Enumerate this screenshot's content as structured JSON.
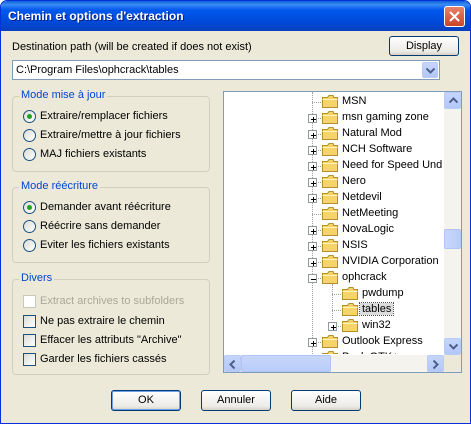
{
  "window": {
    "title": "Chemin et options d'extraction"
  },
  "destination": {
    "label": "Destination path (will be created if does not exist)",
    "display_button": "Display",
    "path_value": "C:\\Program Files\\ophcrack\\tables"
  },
  "update_mode": {
    "title": "Mode mise à jour",
    "options": [
      {
        "label": "Extraire/remplacer fichiers",
        "selected": true
      },
      {
        "label": "Extraire/mettre à jour fichiers",
        "selected": false
      },
      {
        "label": "MAJ fichiers existants",
        "selected": false
      }
    ]
  },
  "overwrite_mode": {
    "title": "Mode réécriture",
    "options": [
      {
        "label": "Demander avant réécriture",
        "selected": true
      },
      {
        "label": "Réécrire sans demander",
        "selected": false
      },
      {
        "label": "Eviter les fichiers existants",
        "selected": false
      }
    ]
  },
  "misc": {
    "title": "Divers",
    "options": [
      {
        "label": "Extract archives to subfolders",
        "checked": false,
        "enabled": false
      },
      {
        "label": "Ne pas extraire le chemin",
        "checked": false,
        "enabled": true
      },
      {
        "label": "Effacer les attributs \"Archive\"",
        "checked": false,
        "enabled": true
      },
      {
        "label": "Garder les fichiers cassés",
        "checked": false,
        "enabled": true
      }
    ]
  },
  "tree": {
    "items": [
      {
        "name": "MSN",
        "level": 1,
        "expander": "none"
      },
      {
        "name": "msn gaming zone",
        "level": 1,
        "expander": "plus"
      },
      {
        "name": "Natural Mod",
        "level": 1,
        "expander": "plus"
      },
      {
        "name": "NCH Software",
        "level": 1,
        "expander": "plus"
      },
      {
        "name": "Need for Speed Und",
        "level": 1,
        "expander": "plus"
      },
      {
        "name": "Nero",
        "level": 1,
        "expander": "plus"
      },
      {
        "name": "Netdevil",
        "level": 1,
        "expander": "plus"
      },
      {
        "name": "NetMeeting",
        "level": 1,
        "expander": "none"
      },
      {
        "name": "NovaLogic",
        "level": 1,
        "expander": "plus"
      },
      {
        "name": "NSIS",
        "level": 1,
        "expander": "plus"
      },
      {
        "name": "NVIDIA Corporation",
        "level": 1,
        "expander": "plus"
      },
      {
        "name": "ophcrack",
        "level": 1,
        "expander": "minus"
      },
      {
        "name": "pwdump",
        "level": 2,
        "expander": "none"
      },
      {
        "name": "tables",
        "level": 2,
        "expander": "none",
        "selected": true
      },
      {
        "name": "win32",
        "level": 2,
        "expander": "plus"
      },
      {
        "name": "Outlook Express",
        "level": 1,
        "expander": "plus"
      },
      {
        "name": "Pack GTK+",
        "level": 1,
        "expander": "plus"
      }
    ]
  },
  "buttons": {
    "ok": "OK",
    "cancel": "Annuler",
    "help": "Aide"
  },
  "colors": {
    "titlebar": "#0058ee",
    "group_title": "#0046d5",
    "dialog_bg": "#ece9d8",
    "folder": "#f5d46a"
  }
}
